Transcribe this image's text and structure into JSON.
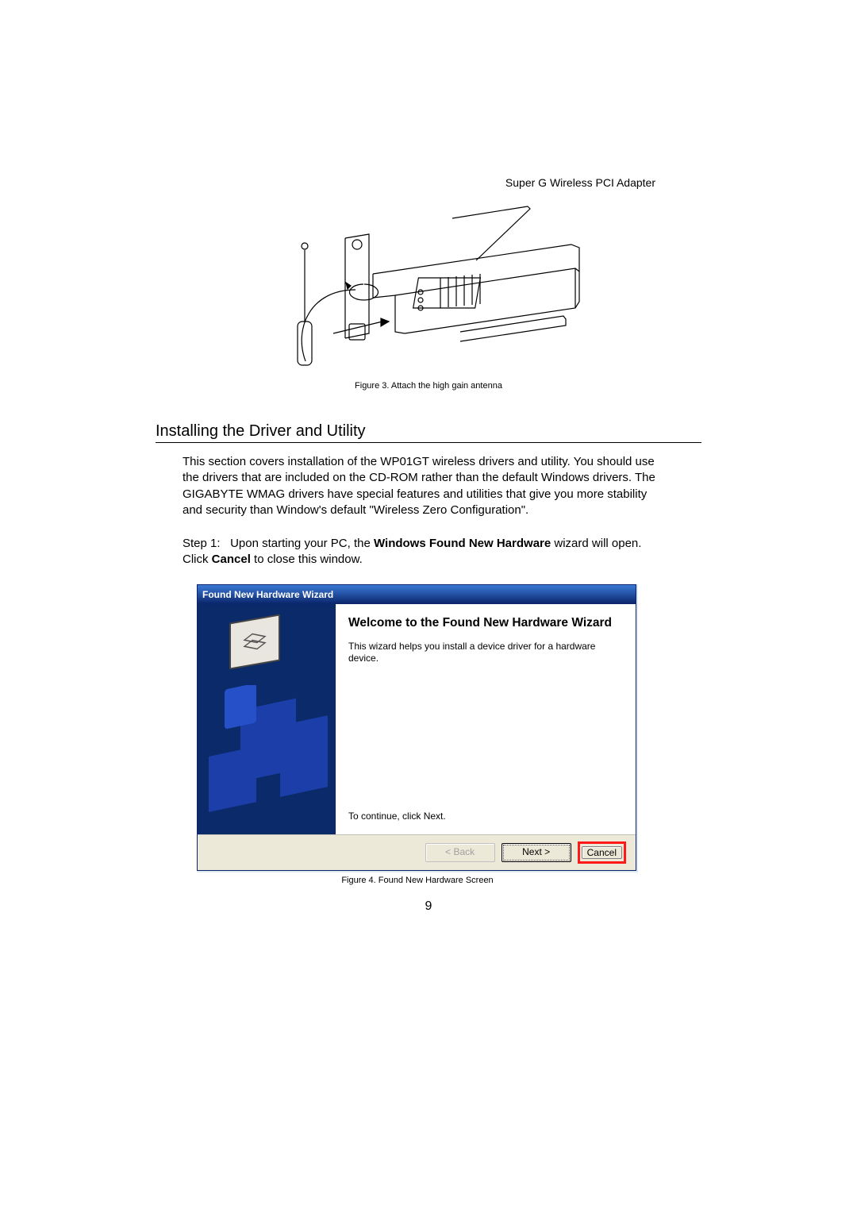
{
  "header": {
    "product": "Super G Wireless PCI Adapter"
  },
  "figure3": {
    "caption": "Figure 3. Attach the high gain antenna"
  },
  "section": {
    "title": "Installing the Driver and Utility"
  },
  "intro": {
    "text": "This section covers installation of the WP01GT wireless drivers and utility. You should use the drivers that are included on the CD-ROM rather than the default Windows drivers. The GIGABYTE WMAG drivers have special features and utilities that give you more stability and security than Window's default \"Wireless Zero Configuration\"."
  },
  "step1": {
    "label": "Step 1:",
    "before_bold": "Upon starting your PC, the ",
    "bold1": "Windows Found New Hardware",
    "mid": " wizard will open. Click ",
    "bold2": "Cancel",
    "after": " to close this window."
  },
  "wizard": {
    "title": "Found New Hardware Wizard",
    "heading": "Welcome to the Found New Hardware Wizard",
    "desc": "This wizard helps you install a device driver for a hardware device.",
    "continue": "To continue, click Next.",
    "back": "< Back",
    "next": "Next >",
    "cancel": "Cancel"
  },
  "figure4": {
    "caption": "Figure 4. Found New Hardware Screen"
  },
  "page": {
    "number": "9"
  }
}
